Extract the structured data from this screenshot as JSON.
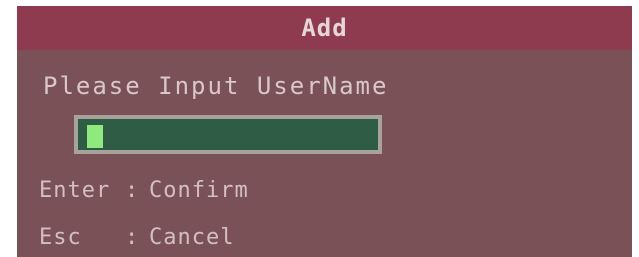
{
  "dialog": {
    "title": "Add",
    "prompt": "Please Input UserName",
    "input": {
      "value": ""
    },
    "hints": [
      {
        "key": "Enter",
        "separator": ":",
        "action": "Confirm"
      },
      {
        "key": "Esc",
        "separator": ":",
        "action": "Cancel"
      }
    ]
  },
  "colors": {
    "dialog_background": "#7a5156",
    "title_bar": "#8e3a4f",
    "input_background": "#2f5c44",
    "input_border": "#a7a39a",
    "cursor": "#8fe97c",
    "text": "#d9c7c9"
  }
}
